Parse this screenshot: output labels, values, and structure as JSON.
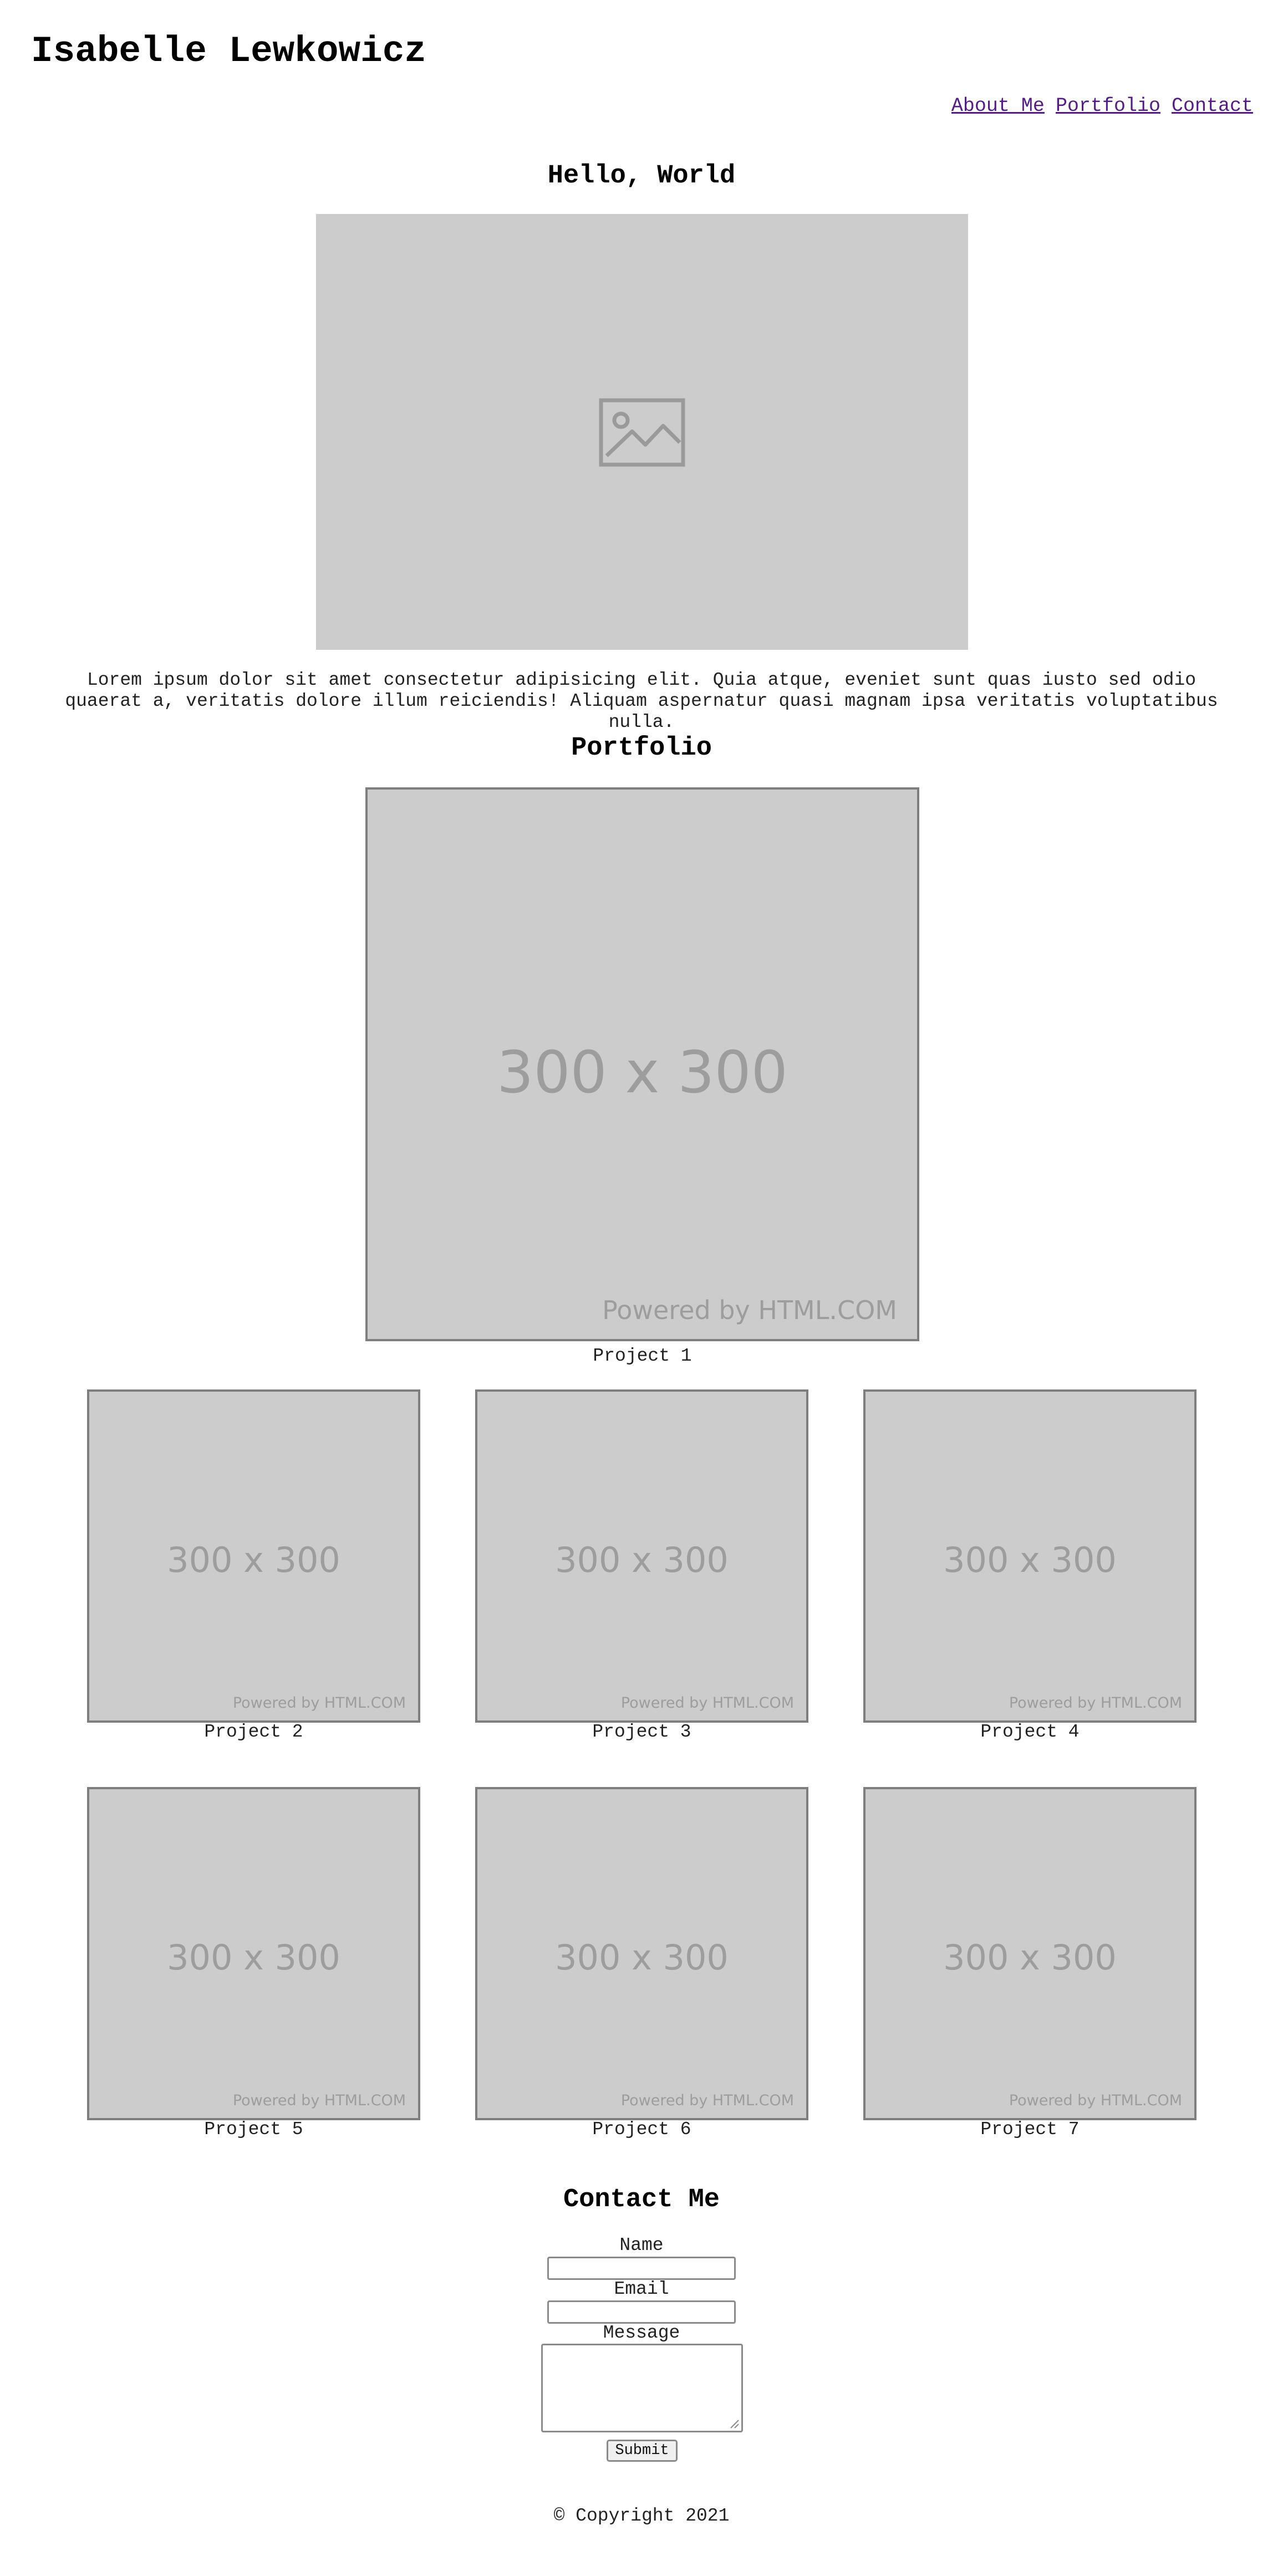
{
  "header": {
    "title": "Isabelle Lewkowicz",
    "nav": [
      "About Me",
      "Portfolio",
      "Contact"
    ]
  },
  "about": {
    "heading": "Hello, World",
    "image_icon": "image-placeholder-icon",
    "text": "Lorem ipsum dolor sit amet consectetur adipisicing elit. Quia atque, eveniet sunt quas iusto sed odio quaerat a, veritatis dolore illum reiciendis! Aliquam aspernatur quasi magnam ipsa veritatis voluptatibus nulla."
  },
  "portfolio": {
    "heading": "Portfolio",
    "placeholder_size": "300 x 300",
    "placeholder_credit": "Powered by HTML.COM",
    "projects": [
      "Project 1",
      "Project 2",
      "Project 3",
      "Project 4",
      "Project 5",
      "Project 6",
      "Project 7"
    ]
  },
  "contact": {
    "heading": "Contact Me",
    "name_label": "Name",
    "name_value": "",
    "email_label": "Email",
    "email_value": "",
    "message_label": "Message",
    "message_value": "",
    "submit_label": "Submit"
  },
  "footer": {
    "copyright": "© Copyright 2021"
  },
  "colors": {
    "link": "#551a8b",
    "placeholder_bg": "#cccccc",
    "placeholder_text": "#9d9d9d"
  }
}
